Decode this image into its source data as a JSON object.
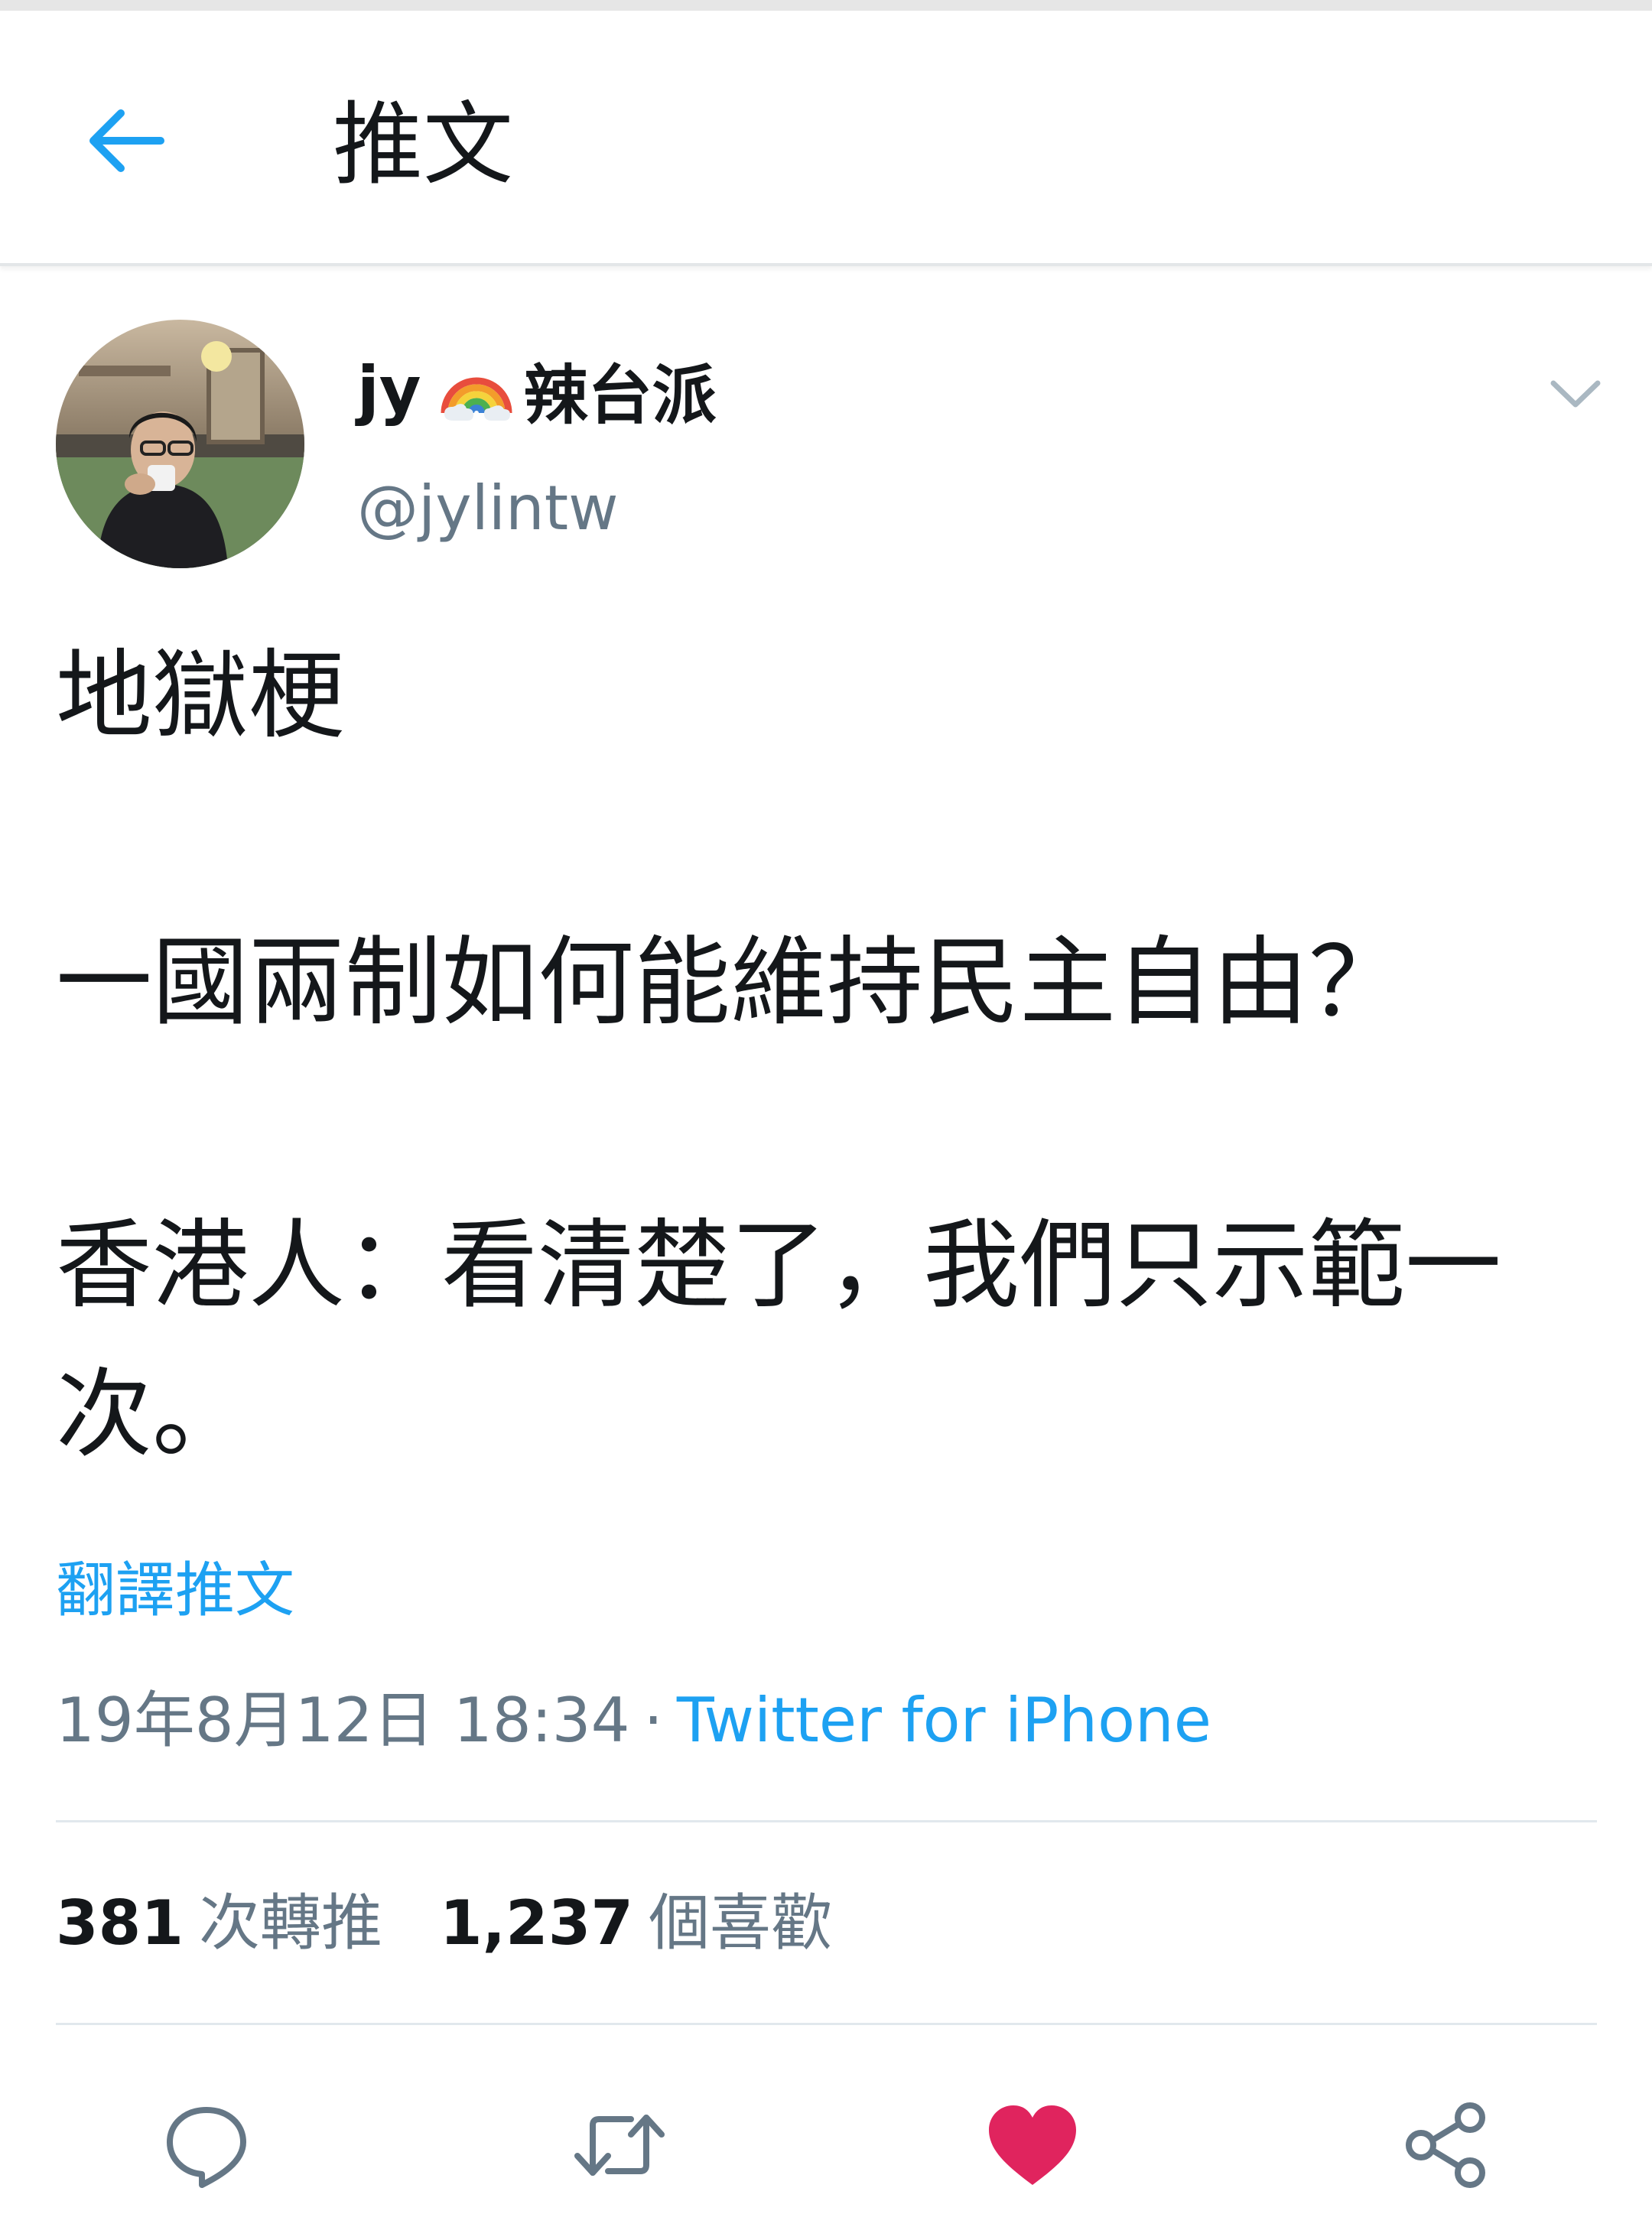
{
  "appbar": {
    "title": "推文",
    "back_icon": "arrow-left-icon"
  },
  "tweet": {
    "display_name_prefix": "jy",
    "display_name_emoji": "rainbow-emoji",
    "display_name_suffix": "辣台派",
    "handle": "@jylintw",
    "text_lines": [
      "地獄梗",
      "一國兩制如何能維持民主自由？",
      "香港人：看清楚了，我們只示範一",
      "次。"
    ],
    "translate_label": "翻譯推文",
    "timestamp": "19年8月12日 18:34",
    "separator": "·",
    "source": "Twitter for iPhone"
  },
  "stats": {
    "retweets_count": "381",
    "retweets_label": "次轉推",
    "likes_count": "1,237",
    "likes_label": "個喜歡"
  },
  "actions": {
    "reply_icon": "reply-bubble-icon",
    "retweet_icon": "retweet-icon",
    "like_icon": "heart-icon",
    "share_icon": "share-icon"
  },
  "colors": {
    "accent_blue": "#1da1f2",
    "secondary_text": "#657786",
    "primary_text": "#14171a",
    "like_red": "#e0245e",
    "divider": "#e1e8ed"
  }
}
